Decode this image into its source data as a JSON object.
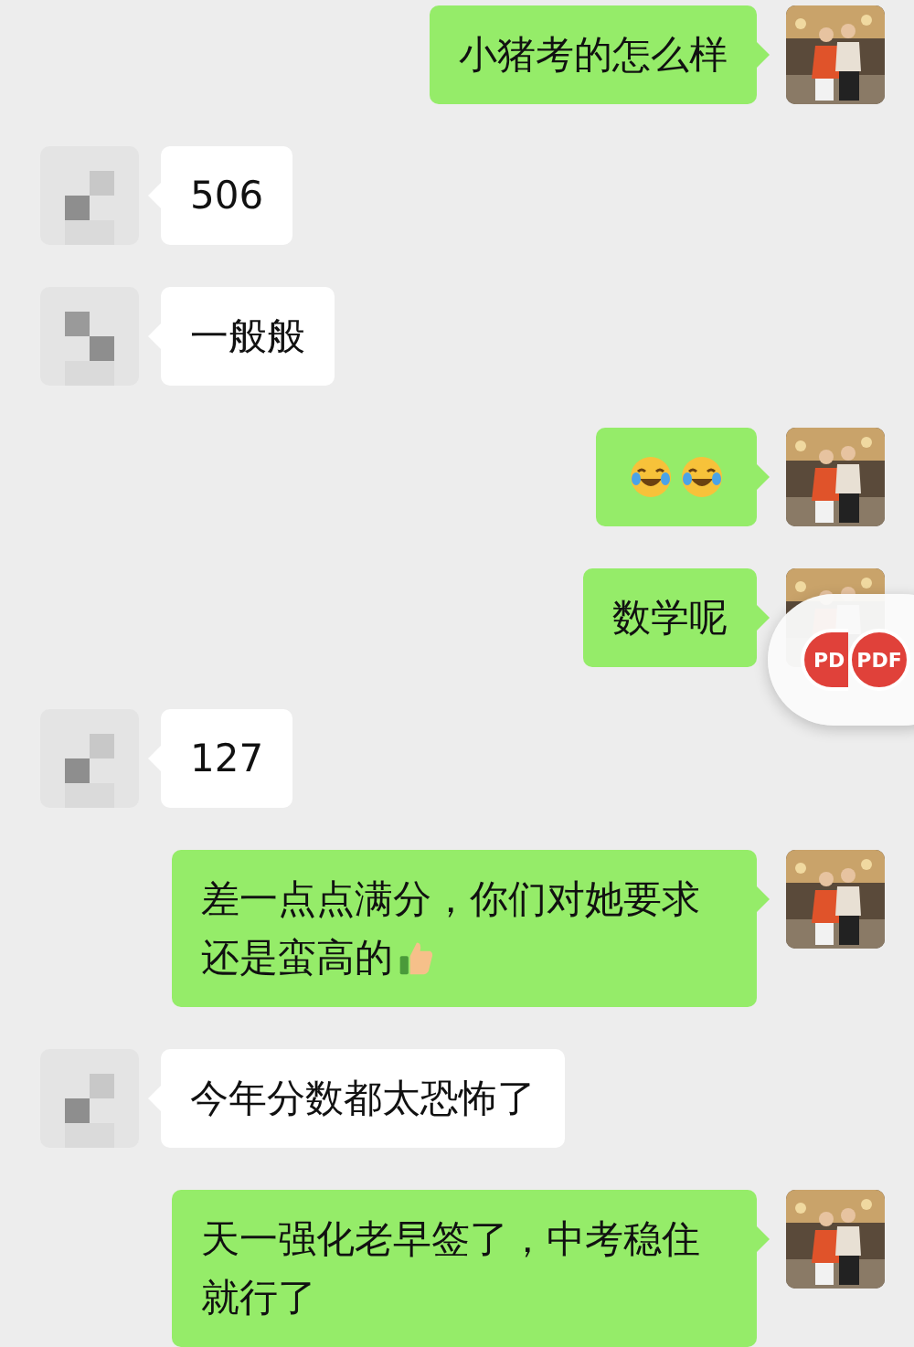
{
  "messages": [
    {
      "kind": "outgoing",
      "parts": [
        {
          "kind": "text",
          "text": "小猪考的怎么样"
        }
      ]
    },
    {
      "kind": "incoming",
      "parts": [
        {
          "kind": "text",
          "text": "506"
        }
      ]
    },
    {
      "kind": "incoming",
      "parts": [
        {
          "kind": "text",
          "text": "一般般"
        }
      ]
    },
    {
      "kind": "outgoing",
      "parts": [
        {
          "kind": "laugh-emoji"
        },
        {
          "kind": "laugh-emoji"
        }
      ]
    },
    {
      "kind": "outgoing",
      "parts": [
        {
          "kind": "text",
          "text": "数学呢"
        }
      ]
    },
    {
      "kind": "incoming",
      "parts": [
        {
          "kind": "text",
          "text": "127"
        }
      ]
    },
    {
      "kind": "outgoing",
      "parts": [
        {
          "kind": "text",
          "text": "差一点点满分，你们对她要求"
        },
        {
          "kind": "text",
          "text": "还是蛮高的"
        },
        {
          "kind": "thumb-emoji"
        }
      ]
    },
    {
      "kind": "incoming",
      "parts": [
        {
          "kind": "text",
          "text": "今年分数都太恐怖了"
        }
      ]
    },
    {
      "kind": "outgoing",
      "parts": [
        {
          "kind": "text",
          "text": "天一强化老早签了，中考稳住就行了"
        }
      ]
    }
  ],
  "floating_widget": {
    "badges": [
      "PD",
      "PDF"
    ]
  }
}
